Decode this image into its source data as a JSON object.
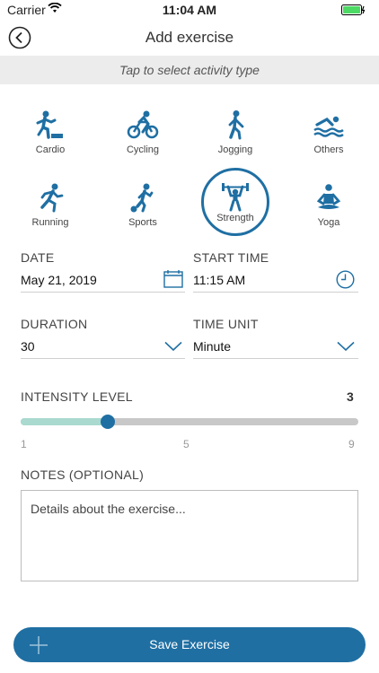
{
  "status_bar": {
    "carrier": "Carrier",
    "time": "11:04 AM"
  },
  "nav": {
    "title": "Add exercise",
    "back_icon": "back-chevron-icon"
  },
  "hint": "Tap to select activity type",
  "activities": [
    {
      "label": "Cardio",
      "icon": "cardio-icon"
    },
    {
      "label": "Cycling",
      "icon": "cycling-icon"
    },
    {
      "label": "Jogging",
      "icon": "jogging-icon"
    },
    {
      "label": "Others",
      "icon": "swimming-icon"
    },
    {
      "label": "Running",
      "icon": "running-icon"
    },
    {
      "label": "Sports",
      "icon": "sports-icon"
    },
    {
      "label": "Strength",
      "icon": "weightlifting-icon",
      "selected": true
    },
    {
      "label": "Yoga",
      "icon": "yoga-icon"
    }
  ],
  "date": {
    "label": "DATE",
    "value": "May 21, 2019"
  },
  "start_time": {
    "label": "START TIME",
    "value": "11:15 AM"
  },
  "duration": {
    "label": "DURATION",
    "value": "30"
  },
  "time_unit": {
    "label": "TIME UNIT",
    "value": "Minute"
  },
  "intensity": {
    "label": "INTENSITY LEVEL",
    "value": "3",
    "min": "1",
    "mid": "5",
    "max": "9"
  },
  "notes": {
    "label": "NOTES (OPTIONAL)",
    "placeholder": "Details about the exercise..."
  },
  "save_label": "Save Exercise",
  "colors": {
    "accent": "#1f6fa3",
    "slider_fill": "#a9d9cf",
    "battery": "#4cd964"
  }
}
